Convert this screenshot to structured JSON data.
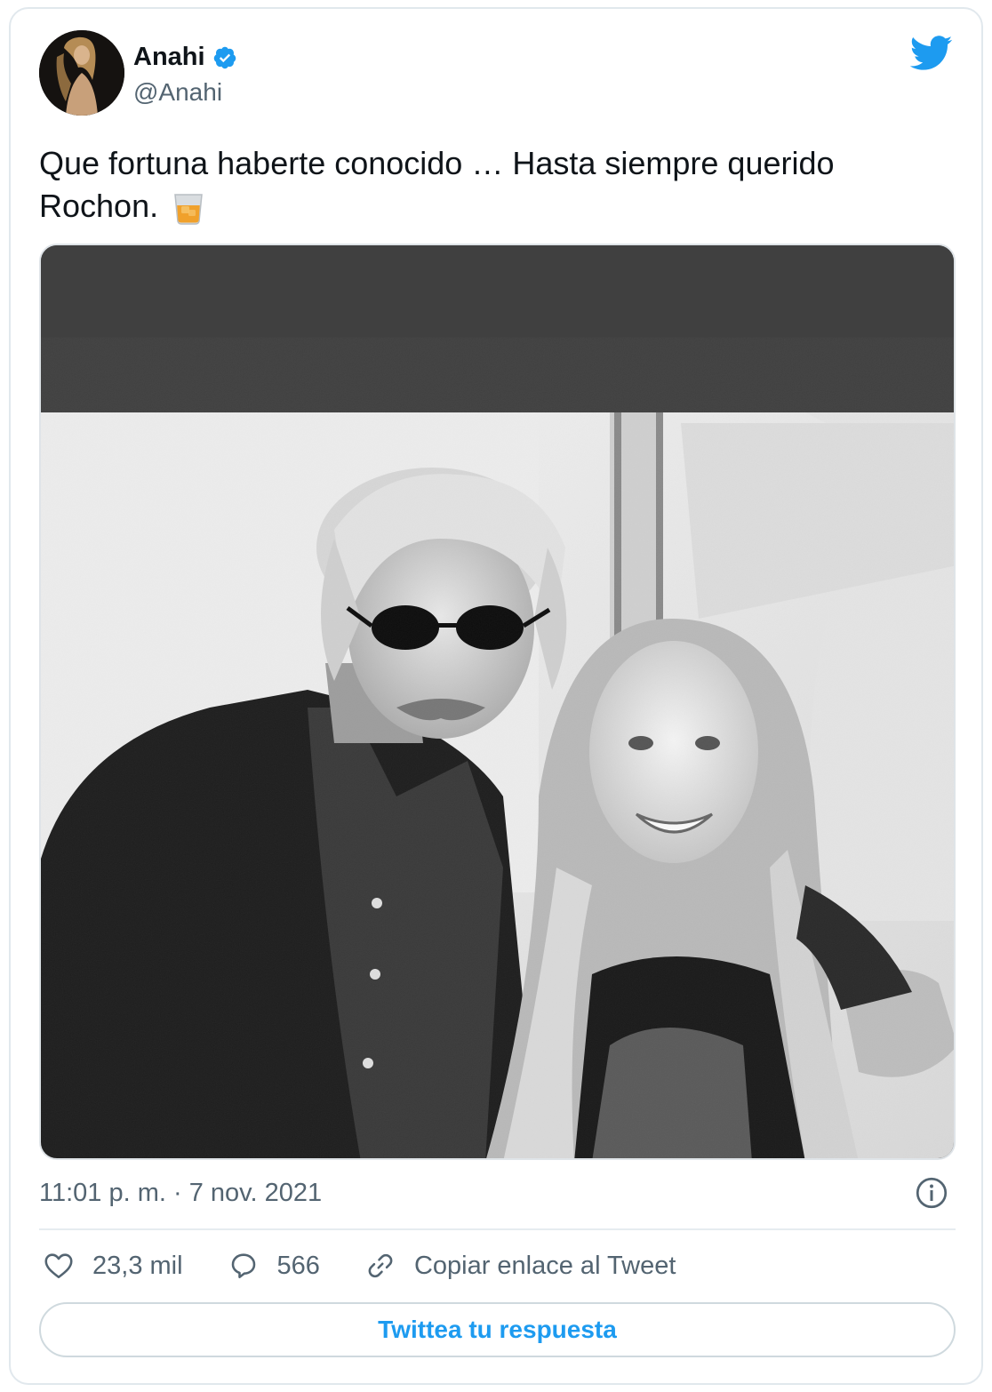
{
  "author": {
    "name": "Anahi",
    "handle": "@Anahi",
    "verified": true
  },
  "tweet": {
    "text_line1": "Que fortuna haberte conocido …  Hasta siempre querido",
    "text_line2": "Rochon.",
    "emoji": "tumbler-glass"
  },
  "meta": {
    "timestamp": "11:01 p. m. · 7 nov. 2021"
  },
  "actions": {
    "likes": "23,3 mil",
    "replies": "566",
    "copy_link": "Copiar enlace al Tweet"
  },
  "reply_button": "Twittea tu respuesta",
  "icons": {
    "brand": "twitter-bird-icon",
    "verified": "verified-badge-icon",
    "info": "info-icon",
    "like": "heart-icon",
    "reply": "comment-bubble-icon",
    "link": "link-icon"
  },
  "colors": {
    "accent": "#1d9bf0",
    "muted": "#536471",
    "text": "#0f1419"
  }
}
